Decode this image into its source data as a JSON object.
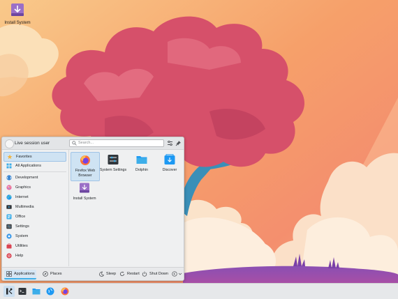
{
  "desktop": {
    "install_icon_label": "Install System"
  },
  "launcher": {
    "user_name": "Live session user",
    "search_placeholder": "Search...",
    "categories": [
      {
        "label": "Favorites",
        "icon": "star-icon"
      },
      {
        "label": "All Applications",
        "icon": "grid-icon"
      },
      {
        "label": "Development",
        "icon": "development-icon"
      },
      {
        "label": "Graphics",
        "icon": "graphics-icon"
      },
      {
        "label": "Internet",
        "icon": "internet-icon"
      },
      {
        "label": "Multimedia",
        "icon": "multimedia-icon"
      },
      {
        "label": "Office",
        "icon": "office-icon"
      },
      {
        "label": "Settings",
        "icon": "settings-icon"
      },
      {
        "label": "System",
        "icon": "system-icon"
      },
      {
        "label": "Utilities",
        "icon": "utilities-icon"
      },
      {
        "label": "Help",
        "icon": "help-icon"
      }
    ],
    "apps": [
      {
        "label": "Firefox Web Browser",
        "icon": "firefox-icon"
      },
      {
        "label": "System Settings",
        "icon": "system-settings-icon"
      },
      {
        "label": "Dolphin",
        "icon": "dolphin-folder-icon"
      },
      {
        "label": "Discover",
        "icon": "discover-icon"
      },
      {
        "label": "Install System",
        "icon": "install-system-icon"
      }
    ],
    "footer": {
      "applications_tab": "Applications",
      "places_tab": "Places",
      "sleep": "Sleep",
      "restart": "Restart",
      "shut_down": "Shut Down"
    }
  },
  "taskbar": {
    "items": [
      "application-launcher-icon",
      "terminal-icon",
      "dolphin-icon",
      "discover-icon",
      "firefox-icon"
    ]
  },
  "colors": {
    "accent": "#3daee9",
    "selection": "#cfe3f3",
    "panel": "#e6e8ea"
  }
}
